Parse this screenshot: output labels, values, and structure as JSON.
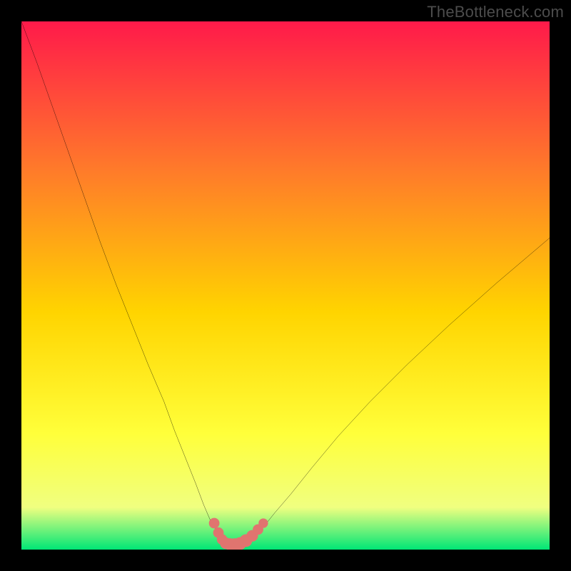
{
  "watermark": "TheBottleneck.com",
  "colors": {
    "frame_bg": "#000000",
    "gradient_top": "#ff1a4a",
    "gradient_mid1": "#ff7a2a",
    "gradient_mid2": "#ffd400",
    "gradient_mid3": "#ffff3a",
    "gradient_mid4": "#f0ff80",
    "gradient_bottom": "#00e676",
    "curve": "#000000",
    "marker": "#e0746f"
  },
  "chart_data": {
    "type": "line",
    "title": "",
    "xlabel": "",
    "ylabel": "",
    "xlim": [
      0,
      100
    ],
    "ylim": [
      0,
      100
    ],
    "grid": false,
    "legend": false,
    "series": [
      {
        "name": "bottleneck-curve",
        "x": [
          0,
          3,
          6,
          9,
          12,
          15,
          18,
          21,
          24,
          27,
          29,
          31,
          33,
          34.5,
          36,
          37.5,
          38.5,
          39.5,
          40.5,
          42,
          44,
          46,
          48,
          51,
          55,
          60,
          66,
          73,
          81,
          90,
          100
        ],
        "y": [
          100,
          92,
          83.5,
          75,
          66.5,
          58,
          50,
          42.5,
          35,
          28,
          22.5,
          17.5,
          12.5,
          8.5,
          5,
          2.8,
          1.6,
          1.0,
          1.0,
          1.3,
          2.5,
          4.5,
          7,
          10.5,
          15.5,
          21.5,
          28,
          35,
          42.5,
          50.5,
          59
        ]
      }
    ],
    "markers": {
      "name": "bottom-cluster",
      "points": [
        {
          "x": 36.5,
          "y": 5.0,
          "r": 1.0
        },
        {
          "x": 37.3,
          "y": 3.2,
          "r": 1.0
        },
        {
          "x": 38.0,
          "y": 1.9,
          "r": 1.0
        },
        {
          "x": 38.7,
          "y": 1.2,
          "r": 1.1
        },
        {
          "x": 39.5,
          "y": 1.0,
          "r": 1.15
        },
        {
          "x": 40.4,
          "y": 1.0,
          "r": 1.15
        },
        {
          "x": 41.4,
          "y": 1.15,
          "r": 1.2
        },
        {
          "x": 42.5,
          "y": 1.7,
          "r": 1.2
        },
        {
          "x": 43.7,
          "y": 2.6,
          "r": 1.1
        },
        {
          "x": 44.8,
          "y": 3.8,
          "r": 1.0
        },
        {
          "x": 45.8,
          "y": 5.0,
          "r": 0.9
        }
      ]
    }
  }
}
